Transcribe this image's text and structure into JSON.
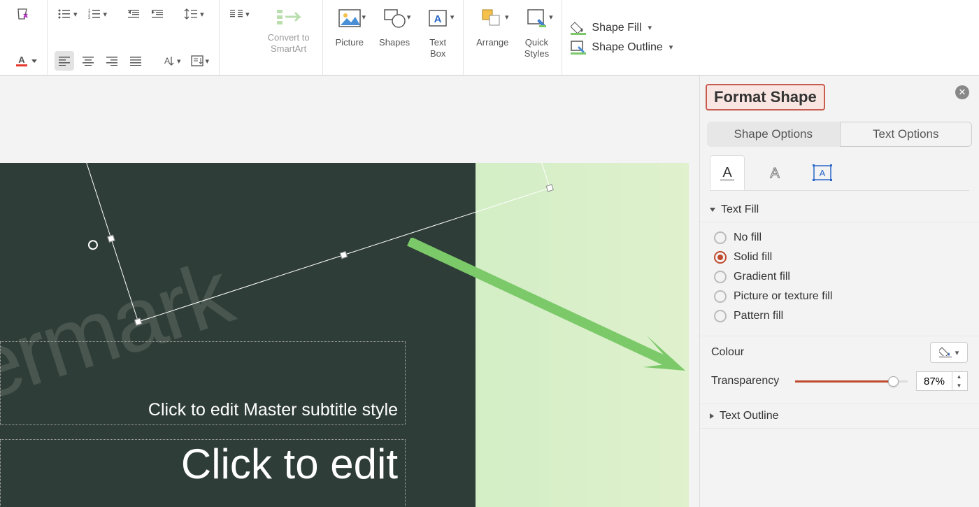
{
  "ribbon": {
    "convert_to_smartart": "Convert to\nSmartArt",
    "picture": "Picture",
    "shapes": "Shapes",
    "text_box": "Text\nBox",
    "arrange": "Arrange",
    "quick_styles": "Quick\nStyles",
    "shape_fill": "Shape Fill",
    "shape_outline": "Shape Outline"
  },
  "canvas": {
    "watermark_text": "termark",
    "subtitle_placeholder": "Click to edit Master subtitle style",
    "title_placeholder": "Click to edit"
  },
  "pane": {
    "title": "Format Shape",
    "tabs": {
      "shape_options": "Shape Options",
      "text_options": "Text Options"
    },
    "sections": {
      "text_fill": "Text Fill",
      "text_outline": "Text Outline"
    },
    "fill": {
      "no_fill": "No fill",
      "solid_fill": "Solid fill",
      "gradient_fill": "Gradient fill",
      "picture_fill": "Picture or texture fill",
      "pattern_fill": "Pattern fill",
      "selected": "solid_fill"
    },
    "colour_label": "Colour",
    "transparency_label": "Transparency",
    "transparency_value": "87%",
    "transparency_pct": 87
  }
}
